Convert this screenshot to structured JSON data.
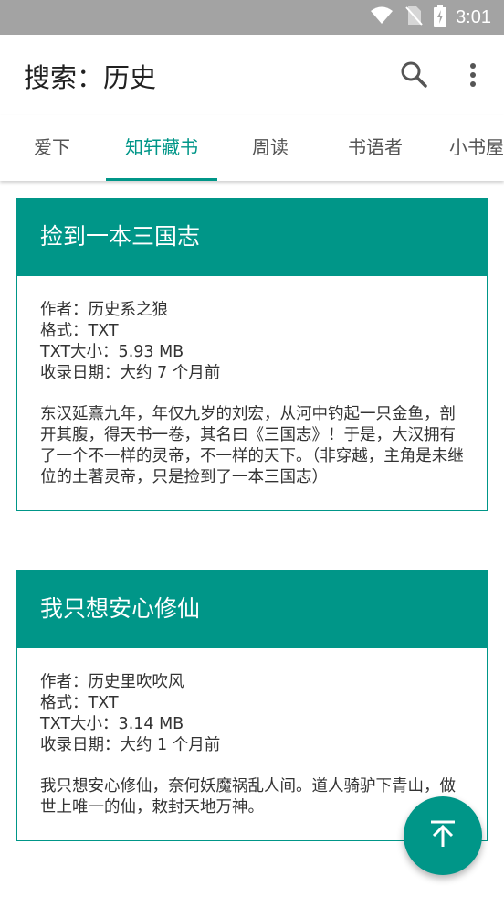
{
  "status_bar": {
    "time": "3:01",
    "icons": [
      "wifi-icon",
      "no-sim-icon",
      "battery-charging-icon"
    ]
  },
  "app_bar": {
    "title": "搜索：历史",
    "icons": [
      "search-icon",
      "more-vert-icon"
    ]
  },
  "tabs": [
    {
      "label": "爱下",
      "active": false
    },
    {
      "label": "知轩藏书",
      "active": true
    },
    {
      "label": "周读",
      "active": false
    },
    {
      "label": "书语者",
      "active": false
    },
    {
      "label": "小书屋",
      "active": false
    }
  ],
  "results": [
    {
      "title": "捡到一本三国志",
      "author": "作者：历史系之狼",
      "format": "格式：TXT",
      "size": "TXT大小：5.93 MB",
      "date": "收录日期：大约 7 个月前",
      "description": "东汉延熹九年，年仅九岁的刘宏，从河中钓起一只金鱼，剖开其腹，得天书一卷，其名曰《三国志》！于是，大汉拥有了一个不一样的灵帝，不一样的天下。（非穿越，主角是未继位的土著灵帝，只是捡到了一本三国志）"
    },
    {
      "title": "我只想安心修仙",
      "author": "作者：历史里吹吹风",
      "format": "格式：TXT",
      "size": "TXT大小：3.14 MB",
      "date": "收录日期：大约 1 个月前",
      "description": "我只想安心修仙，奈何妖魔祸乱人间。道人骑驴下青山，做世上唯一的仙，敕封天地万神。"
    }
  ],
  "fab": {
    "icon": "arrow-up-icon"
  },
  "colors": {
    "accent": "#009688",
    "status_bar": "#a3a3a3"
  }
}
